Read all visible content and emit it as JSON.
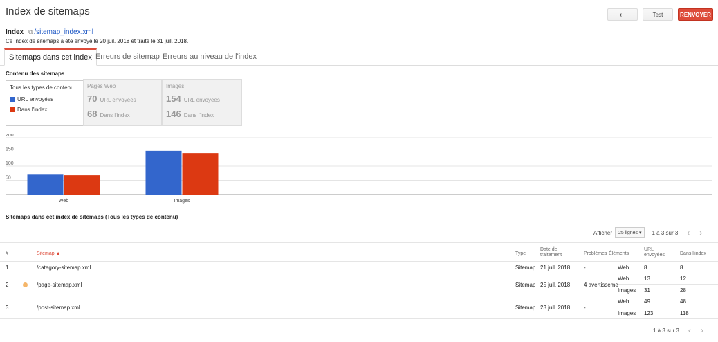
{
  "header": {
    "title": "Index de sitemaps",
    "back_icon": "↤",
    "test_label": "Test",
    "resend_label": "RENVOYER"
  },
  "index_info": {
    "label": "Index",
    "path": "/sitemap_index.xml",
    "submitted_text": "Ce Index de sitemaps a été envoyé le 20 juil. 2018 et traité le 31 juil. 2018."
  },
  "tabs": [
    {
      "label": "Sitemaps dans cet index",
      "active": true
    },
    {
      "label": "Erreurs de sitemap",
      "active": false
    },
    {
      "label": "Erreurs au niveau de l'index",
      "active": false
    }
  ],
  "content_section": {
    "title": "Contenu des sitemaps",
    "all_types_label": "Tous les types de contenu",
    "legend": [
      {
        "label": "URL envoyées",
        "color": "#3366cc"
      },
      {
        "label": "Dans l'index",
        "color": "#dc3912"
      }
    ],
    "web": {
      "label": "Pages Web",
      "submitted": "70",
      "submitted_label": "URL envoyées",
      "indexed": "68",
      "indexed_label": "Dans l'index"
    },
    "images": {
      "label": "Images",
      "submitted": "154",
      "submitted_label": "URL envoyées",
      "indexed": "146",
      "indexed_label": "Dans l'index"
    }
  },
  "chart_data": {
    "type": "bar",
    "categories": [
      "Web",
      "Images"
    ],
    "series": [
      {
        "name": "URL envoyées",
        "values": [
          70,
          154
        ],
        "color": "#3366cc"
      },
      {
        "name": "Dans l'index",
        "values": [
          68,
          146
        ],
        "color": "#dc3912"
      }
    ],
    "yticks": [
      "200",
      "150",
      "100",
      "50"
    ],
    "ylim": [
      0,
      200
    ]
  },
  "table": {
    "title": "Sitemaps dans cet index de sitemaps (Tous les types de contenu)",
    "show_label": "Afficher",
    "rows_per_page": "25 lignes",
    "page_info": "1 à 3 sur 3",
    "prev_icon": "‹",
    "next_icon": "›",
    "columns": {
      "num": "#",
      "sitemap": "Sitemap ▲",
      "type": "Type",
      "date": "Date de traitement",
      "problems": "Problèmes",
      "elements": "Éléments",
      "submitted": "URL envoyées",
      "indexed": "Dans l'index"
    },
    "rows": [
      {
        "num": "1",
        "sitemap": "/category-sitemap.xml",
        "type": "Sitemap",
        "date": "21 juil. 2018",
        "problems": "-",
        "items": [
          {
            "element": "Web",
            "submitted": "8",
            "indexed": "8"
          }
        ]
      },
      {
        "num": "2",
        "sitemap": "/page-sitemap.xml",
        "type": "Sitemap",
        "date": "25 juil. 2018",
        "problems": "4 avertisseme",
        "items": [
          {
            "element": "Web",
            "submitted": "13",
            "indexed": "12"
          },
          {
            "element": "Images",
            "submitted": "31",
            "indexed": "28"
          }
        ]
      },
      {
        "num": "3",
        "sitemap": "/post-sitemap.xml",
        "type": "Sitemap",
        "date": "23 juil. 2018",
        "problems": "-",
        "items": [
          {
            "element": "Web",
            "submitted": "49",
            "indexed": "48"
          },
          {
            "element": "Images",
            "submitted": "123",
            "indexed": "118"
          }
        ]
      }
    ]
  }
}
